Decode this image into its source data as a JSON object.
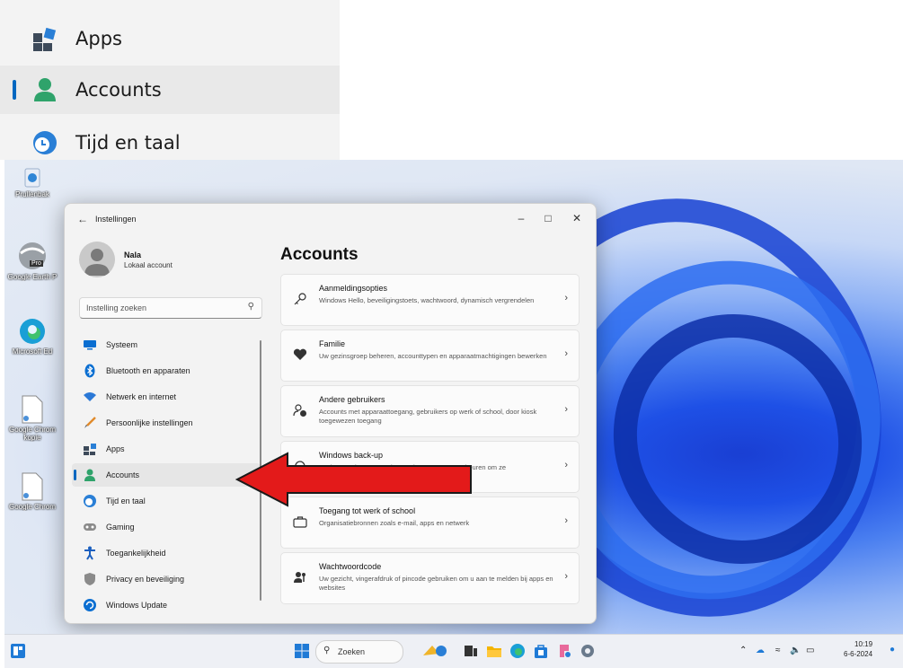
{
  "zoom_panel": {
    "items": [
      {
        "label": "Apps"
      },
      {
        "label": "Accounts"
      },
      {
        "label": "Tijd en taal"
      }
    ]
  },
  "desktop": {
    "icons": [
      {
        "label": "Prullenbak"
      },
      {
        "label": "Google Earth P"
      },
      {
        "label": "Microsoft Ed"
      },
      {
        "label": "Google Chrom kopie"
      },
      {
        "label": "Google Chrom"
      }
    ],
    "badge_pro": "Pro"
  },
  "window": {
    "title": "Instellingen",
    "user": {
      "name": "Nala",
      "type": "Lokaal account"
    },
    "search_placeholder": "Instelling zoeken",
    "nav": [
      {
        "label": "Systeem",
        "icon": "monitor-icon",
        "color": "#0a6ed1"
      },
      {
        "label": "Bluetooth en apparaten",
        "icon": "bluetooth-icon",
        "color": "#0a6ed1"
      },
      {
        "label": "Netwerk en internet",
        "icon": "wifi-icon",
        "color": "#2b78d6"
      },
      {
        "label": "Persoonlijke instellingen",
        "icon": "brush-icon",
        "color": "#e08a2b"
      },
      {
        "label": "Apps",
        "icon": "apps-icon",
        "color": "#3d4a5a"
      },
      {
        "label": "Accounts",
        "icon": "person-icon",
        "color": "#2fa36b"
      },
      {
        "label": "Tijd en taal",
        "icon": "clock-globe-icon",
        "color": "#2a7fd6"
      },
      {
        "label": "Gaming",
        "icon": "controller-icon",
        "color": "#8a8a8a"
      },
      {
        "label": "Toegankelijkheid",
        "icon": "accessibility-icon",
        "color": "#1b5fbf"
      },
      {
        "label": "Privacy en beveiliging",
        "icon": "shield-icon",
        "color": "#777777"
      },
      {
        "label": "Windows Update",
        "icon": "update-icon",
        "color": "#0a6ed1"
      }
    ],
    "content_title": "Accounts",
    "cards": [
      {
        "title": "Aanmeldingsopties",
        "desc": "Windows Hello, beveiligingstoets, wachtwoord, dynamisch vergrendelen",
        "icon": "key-icon"
      },
      {
        "title": "Familie",
        "desc": "Uw gezinsgroep beheren, accounttypen en apparaatmachtigingen bewerken",
        "icon": "heart-icon"
      },
      {
        "title": "Andere gebruikers",
        "desc": "Accounts met apparaattoegang, gebruikers op werk of school, door kiosk toegewezen toegang",
        "icon": "add-user-icon"
      },
      {
        "title": "Windows back-up",
        "desc": "Back-up maken van uw bestanden, apps en voorkeuren om ze",
        "icon": "backup-icon"
      },
      {
        "title": "Toegang tot werk of school",
        "desc": "Organisatiebronnen zoals e-mail, apps en netwerk",
        "icon": "briefcase-icon"
      },
      {
        "title": "Wachtwoordcode",
        "desc": "Uw gezicht, vingerafdruk of pincode gebruiken om u aan te melden bij apps en websites",
        "icon": "passkey-icon"
      }
    ]
  },
  "taskbar": {
    "search_placeholder": "Zoeken",
    "time": "10:19",
    "date": "6-6-2024"
  },
  "colors": {
    "accent": "#0067c0",
    "arrow": "#e31a1a",
    "wallpaper": "#1e50e6"
  }
}
